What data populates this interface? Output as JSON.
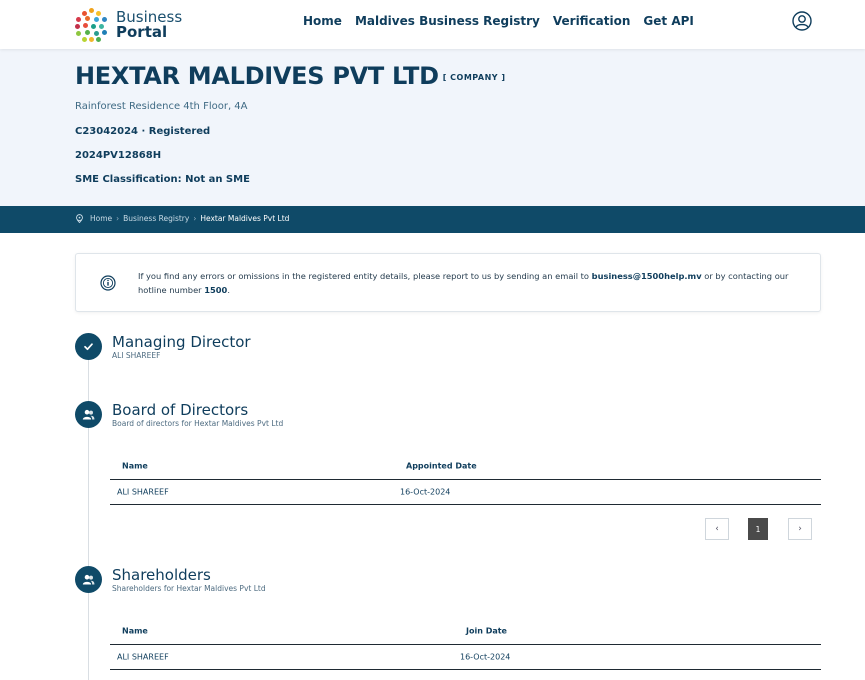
{
  "brand": {
    "line1": "Business",
    "line2": "Portal"
  },
  "nav": {
    "items": [
      "Home",
      "Maldives Business Registry",
      "Verification",
      "Get API"
    ]
  },
  "company": {
    "name": "HEXTAR MALDIVES PVT LTD",
    "type": "[ COMPANY ]",
    "address": "Rainforest Residence 4th Floor, 4A",
    "registration": "C23042024 · Registered",
    "tax_id": "2024PV12868H",
    "sme": "SME Classification: Not an SME"
  },
  "breadcrumb": {
    "home": "Home",
    "registry": "Business Registry",
    "current": "Hextar Maldives Pvt Ltd",
    "separator": "›"
  },
  "notice": {
    "text_before": "If you find any errors or omissions in the registered entity details, please report to us by sending an email to ",
    "email": "business@1500help.mv",
    "text_middle": " or by contacting our hotline number ",
    "hotline": "1500",
    "text_after": "."
  },
  "managing_director": {
    "title": "Managing Director",
    "name": "ALI SHAREEF"
  },
  "board": {
    "title": "Board of Directors",
    "subtitle": "Board of directors for Hextar Maldives Pvt Ltd",
    "columns": [
      "Name",
      "Appointed Date"
    ],
    "rows": [
      {
        "name": "ALI SHAREEF",
        "date": "16-Oct-2024"
      }
    ],
    "pagination": {
      "prev": "‹",
      "page": "1",
      "next": "›"
    }
  },
  "shareholders": {
    "title": "Shareholders",
    "subtitle": "Shareholders for Hextar Maldives Pvt Ltd",
    "columns": [
      "Name",
      "Join Date"
    ],
    "rows": [
      {
        "name": "ALI SHAREEF",
        "date": "16-Oct-2024"
      }
    ]
  },
  "colors": {
    "primary": "#0f4a68",
    "hero_bg": "#f1f5fb",
    "text": "#0f3d5c"
  },
  "icons": {
    "user": "user-circle-icon",
    "pin": "location-pin-icon",
    "info": "info-icon",
    "check": "check-icon",
    "group": "users-icon"
  }
}
